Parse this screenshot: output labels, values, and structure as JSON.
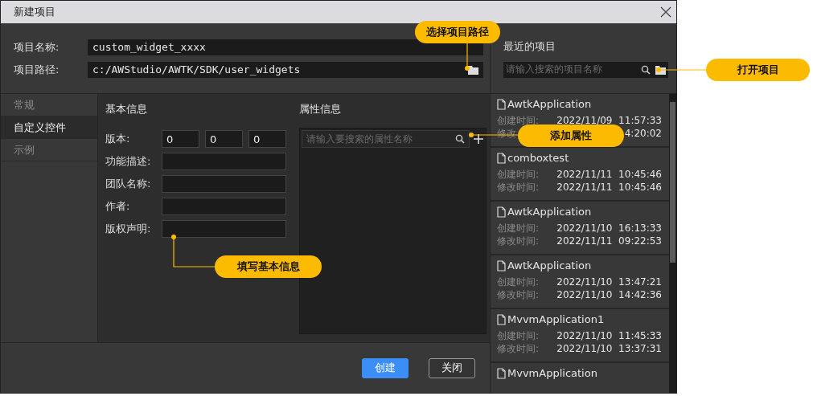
{
  "window": {
    "title": "新建项目"
  },
  "project": {
    "fields": [
      {
        "label": "项目名称:",
        "value": "custom_widget_xxxx"
      },
      {
        "label": "项目路径:",
        "value": "c:/AWStudio/AWTK/SDK/user_widgets"
      }
    ]
  },
  "recent": {
    "title": "最近的项目",
    "search": {
      "placeholder": "请输入搜索的项目名称"
    },
    "items": [
      {
        "name": "AwtkApplication",
        "rows": [
          {
            "label": "创建时间:",
            "value": "2022/11/09  11:57:33"
          },
          {
            "label": "修改",
            "value": "4:20:02"
          }
        ]
      },
      {
        "name": "comboxtest",
        "rows": [
          {
            "label": "创建时间:",
            "value": "2022/11/11  10:45:46"
          },
          {
            "label": "修改时间:",
            "value": "2022/11/11  10:45:46"
          }
        ]
      },
      {
        "name": "AwtkApplication",
        "rows": [
          {
            "label": "创建时间:",
            "value": "2022/11/10  16:13:33"
          },
          {
            "label": "修改时间:",
            "value": "2022/11/11  09:22:53"
          }
        ]
      },
      {
        "name": "AwtkApplication",
        "rows": [
          {
            "label": "创建时间:",
            "value": "2022/11/10  13:47:21"
          },
          {
            "label": "修改时间:",
            "value": "2022/11/10  14:42:36"
          }
        ]
      },
      {
        "name": "MvvmApplication1",
        "rows": [
          {
            "label": "创建时间:",
            "value": "2022/11/10  11:45:33"
          },
          {
            "label": "修改时间:",
            "value": "2022/11/10  13:37:31"
          }
        ]
      },
      {
        "name": "MvvmApplication"
      }
    ]
  },
  "nav": [
    {
      "label": "常规",
      "selected": false
    },
    {
      "label": "自定义控件",
      "selected": true
    },
    {
      "label": "示例",
      "selected": false
    }
  ],
  "basic": {
    "title": "基本信息",
    "version": {
      "label": "版本:",
      "values": [
        "0",
        "0",
        "0"
      ]
    },
    "fields": [
      {
        "label": "功能描述:"
      },
      {
        "label": "团队名称:"
      },
      {
        "label": "作者:"
      },
      {
        "label": "版权声明:"
      }
    ]
  },
  "attributes": {
    "title": "属性信息",
    "search": {
      "placeholder": "请输入要搜索的属性名称"
    }
  },
  "buttons": [
    {
      "label": "创建",
      "kind": "primary"
    },
    {
      "label": "关闭",
      "kind": "secondary"
    }
  ],
  "callouts": [
    {
      "text": "选择项目路径"
    },
    {
      "text": "打开项目"
    },
    {
      "text": "添加属性"
    },
    {
      "text": "填写基本信息"
    }
  ]
}
